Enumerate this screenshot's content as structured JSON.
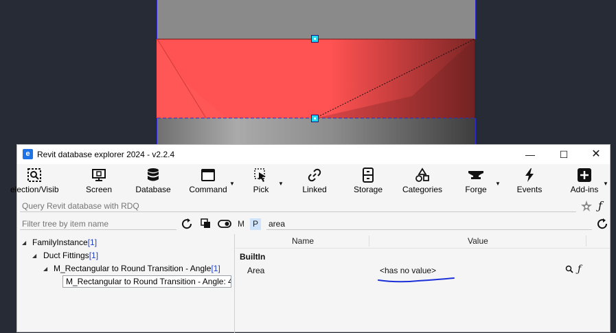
{
  "window": {
    "title": "Revit database explorer 2024 - v2.2.4",
    "app_icon_letter": "e",
    "minimize": "—",
    "maximize": "☐",
    "close": "✕"
  },
  "toolbar": {
    "items": [
      {
        "label": "election/Visib",
        "icon": "selection-visibility-icon"
      },
      {
        "label": "Screen",
        "icon": "screen-icon"
      },
      {
        "label": "Database",
        "icon": "database-icon"
      },
      {
        "label": "Command",
        "icon": "command-icon"
      },
      {
        "label": "Pick",
        "icon": "pick-icon"
      },
      {
        "label": "Linked",
        "icon": "link-icon"
      },
      {
        "label": "Storage",
        "icon": "storage-icon"
      },
      {
        "label": "Categories",
        "icon": "categories-icon"
      },
      {
        "label": "Forge",
        "icon": "forge-icon"
      },
      {
        "label": "Events",
        "icon": "events-icon"
      },
      {
        "label": "Add-ins",
        "icon": "add-ins-icon"
      }
    ]
  },
  "rdq": {
    "placeholder": "Query Revit database with RDQ",
    "f_symbol": "ƒ"
  },
  "filter": {
    "placeholder": "Filter tree by item name",
    "m_label": "M",
    "p_label": "P",
    "search_value": "area"
  },
  "tree": {
    "items": [
      {
        "label": "FamilyInstance",
        "count": "[1]"
      },
      {
        "label": "Duct Fittings",
        "count": "[1]"
      },
      {
        "label": "M_Rectangular to Round Transition - Angle",
        "count": "[1]"
      },
      {
        "label": "M_Rectangular to Round Transition - Angle: 4",
        "count": ""
      }
    ]
  },
  "props": {
    "col_name": "Name",
    "col_value": "Value",
    "section": "BuiltIn",
    "rows": [
      {
        "name": "Area",
        "value": "<has no value>",
        "f_symbol": "ƒ"
      }
    ]
  },
  "colors": {
    "duct_red": "#ff5252",
    "grip": "#25d7f0",
    "count_blue": "#1f3ec4",
    "scribble_blue": "#1a2fd8"
  }
}
